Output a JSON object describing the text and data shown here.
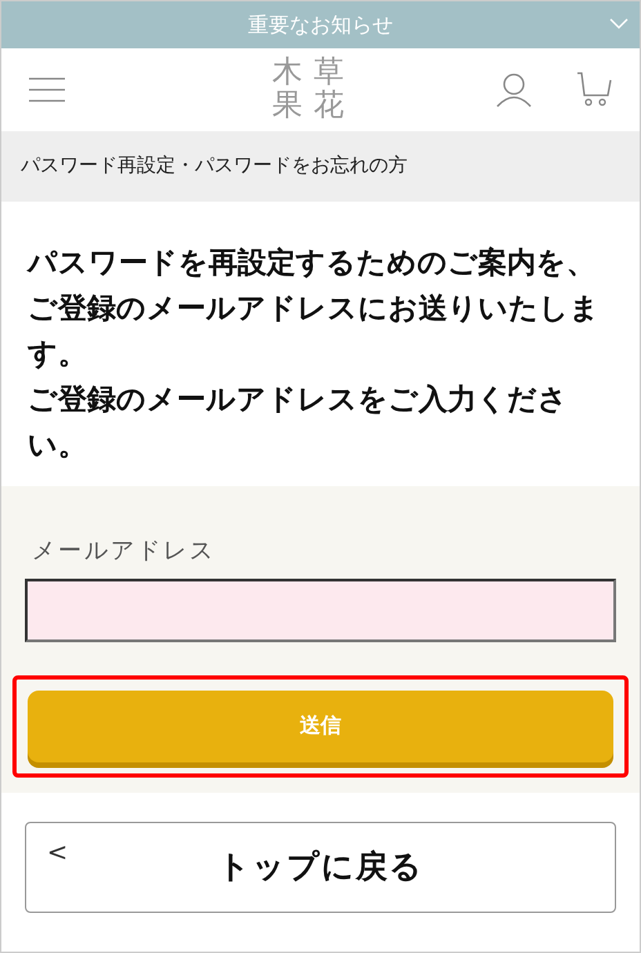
{
  "notice_bar": {
    "title": "重要なお知らせ",
    "expanded": false
  },
  "header": {
    "logo": [
      "木",
      "草",
      "果",
      "花"
    ]
  },
  "breadcrumb": "パスワード再設定・パスワードをお忘れの方",
  "intro": [
    "パスワードを再設定するためのご案内を、ご登録のメールアドレスにお送りいたします。",
    "ご登録のメールアドレスをご入力ください。"
  ],
  "form": {
    "label": "メールアドレス",
    "submit": {
      "label": "送信",
      "highlighted": true
    }
  },
  "back_button": {
    "icon": "<",
    "label": "トップに戻る"
  }
}
